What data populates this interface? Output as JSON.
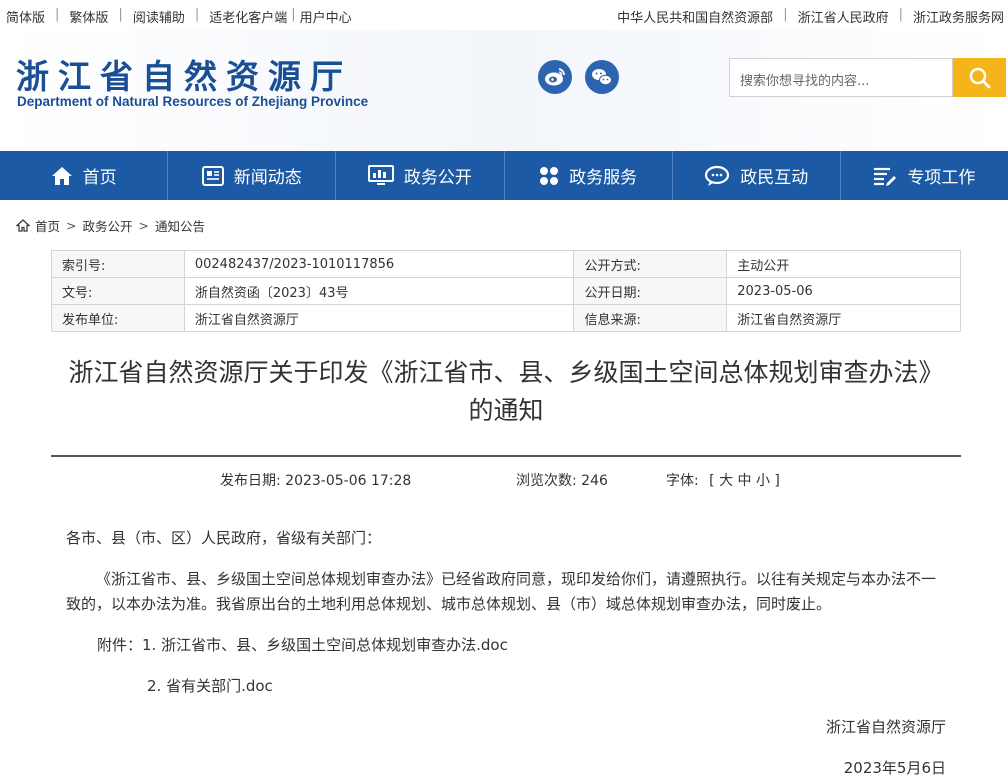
{
  "topbar": {
    "left": [
      "简体版",
      "繁体版",
      "阅读辅助",
      "适老化客户端",
      "用户中心"
    ],
    "right": [
      "中华人民共和国自然资源部",
      "浙江省人民政府",
      "浙江政务服务网"
    ]
  },
  "header": {
    "logo_cn": "浙江省自然资源厅",
    "logo_en": "Department of Natural Resources of Zhejiang Province",
    "search_placeholder": "搜索你想寻找的内容..."
  },
  "nav": [
    {
      "label": "首页",
      "icon": "home-icon"
    },
    {
      "label": "新闻动态",
      "icon": "news-icon"
    },
    {
      "label": "政务公开",
      "icon": "monitor-icon"
    },
    {
      "label": "政务服务",
      "icon": "grid-icon"
    },
    {
      "label": "政民互动",
      "icon": "chat-icon"
    },
    {
      "label": "专项工作",
      "icon": "list-icon"
    }
  ],
  "breadcrumb": [
    "首页",
    "政务公开",
    "通知公告"
  ],
  "info": {
    "index_label": "索引号:",
    "index_value": "002482437/2023-1010117856",
    "mode_label": "公开方式:",
    "mode_value": "主动公开",
    "doc_label": "文号:",
    "doc_value": "浙自然资函〔2023〕43号",
    "date_label": "公开日期:",
    "date_value": "2023-05-06",
    "unit_label": "发布单位:",
    "unit_value": "浙江省自然资源厅",
    "source_label": "信息来源:",
    "source_value": "浙江省自然资源厅"
  },
  "article": {
    "title_line1": "浙江省自然资源厅关于印发《浙江省市、县、乡级国土空间总体规划审查办法》",
    "title_line2": "的通知",
    "publish_date": "发布日期: 2023-05-06 17:28",
    "views": "浏览次数: 246",
    "font_label": "字体:",
    "font_options": "[ 大 中 小 ]",
    "salutation": "各市、县（市、区）人民政府，省级有关部门：",
    "paragraph": "《浙江省市、县、乡级国土空间总体规划审查办法》已经省政府同意，现印发给你们，请遵照执行。以往有关规定与本办法不一致的，以本办法为准。我省原出台的土地利用总体规划、城市总体规划、县（市）域总体规划审查办法，同时废止。",
    "attachment_label": "附件：",
    "attachment1": "1. 浙江省市、县、乡级国土空间总体规划审查办法.doc",
    "attachment2": "2. 省有关部门.doc",
    "signature": "浙江省自然资源厅",
    "sign_date": "2023年5月6日"
  }
}
